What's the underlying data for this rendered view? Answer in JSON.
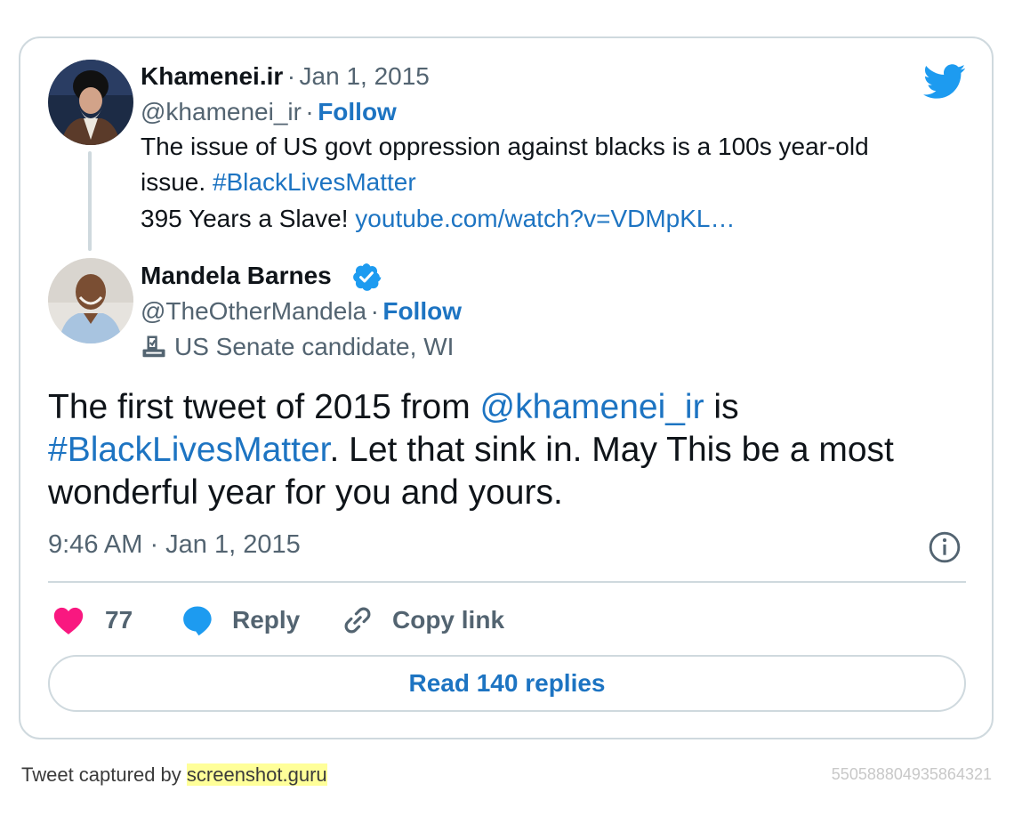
{
  "quoted": {
    "name": "Khamenei.ir",
    "separator": "·",
    "date": "Jan 1, 2015",
    "handle": "@khamenei_ir",
    "follow_label": "Follow",
    "text_line1": "The issue of US govt oppression against blacks is a 100s year-old",
    "text_line2_prefix": "issue. ",
    "hashtag": "#BlackLivesMatter",
    "text_line3_prefix": "395 Years a Slave! ",
    "link": "youtube.com/watch?v=VDMpKL…"
  },
  "author": {
    "name": "Mandela Barnes",
    "handle": "@TheOtherMandela",
    "separator": "·",
    "follow_label": "Follow",
    "label": "US Senate candidate, WI",
    "verified_icon": "verified-badge-icon",
    "label_icon": "ballot-box-icon"
  },
  "tweet": {
    "part1": "The first tweet of 2015 from ",
    "mention": "@khamenei_ir",
    "part2": " is",
    "hashtag": "#BlackLivesMatter",
    "part3": ". Let that sink in. May This be a most",
    "line3": "wonderful year for you and yours.",
    "timestamp": "9:46 AM · Jan 1, 2015"
  },
  "actions": {
    "like_count": "77",
    "reply_label": "Reply",
    "copy_link_label": "Copy link",
    "read_replies_label": "Read 140 replies"
  },
  "footer": {
    "prefix": "Tweet captured by ",
    "brand": "screenshot.guru",
    "tweet_id": "550588804935864321"
  },
  "colors": {
    "link": "#1d74c2",
    "muted": "#536471",
    "heart": "#f91880",
    "reply_bubble": "#1d9bf0",
    "twitter_blue": "#1d9bf0",
    "border": "#cfd9de",
    "highlight": "#ffff99"
  }
}
